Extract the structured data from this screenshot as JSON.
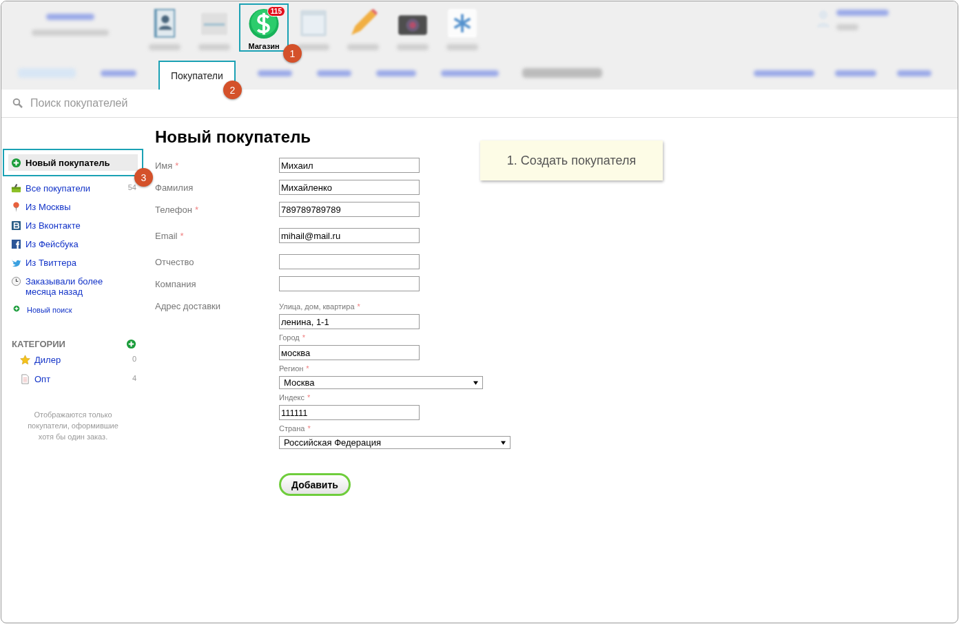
{
  "apps": [
    {
      "kind": "blurred",
      "selected": false
    },
    {
      "kind": "blurred",
      "selected": false
    },
    {
      "kind": "app",
      "label": "Магазин",
      "badge": "115",
      "selected": true
    },
    {
      "kind": "blurred",
      "selected": false
    },
    {
      "kind": "blurred",
      "selected": false
    },
    {
      "kind": "blurred",
      "selected": false
    },
    {
      "kind": "blurred",
      "selected": false
    }
  ],
  "tabs": [
    {
      "kind": "blurred",
      "selected": false
    },
    {
      "kind": "blurred",
      "selected": false
    },
    {
      "kind": "tab",
      "label": "Покупатели",
      "selected": true
    },
    {
      "kind": "blurred",
      "selected": false
    },
    {
      "kind": "blurred",
      "selected": false
    },
    {
      "kind": "blurred",
      "selected": false
    },
    {
      "kind": "blurred",
      "selected": false
    }
  ],
  "search": {
    "placeholder": "Поиск покупателей"
  },
  "sidebar": {
    "new_customer": {
      "label": "Новый покупатель",
      "selected": true
    },
    "filters": [
      {
        "label": "Все покупатели",
        "count": "54"
      },
      {
        "label": "Из Москвы"
      },
      {
        "label": "Из Вконтакте"
      },
      {
        "label": "Из Фейсбука"
      },
      {
        "label": "Из Твиттера"
      },
      {
        "label": "Заказывали более месяца назад"
      }
    ],
    "new_search": "Новый поиск",
    "categories": {
      "title": "КАТЕГОРИИ",
      "items": [
        {
          "label": "Дилер",
          "count": "0"
        },
        {
          "label": "Опт",
          "count": "4"
        }
      ]
    },
    "note": "Отображаются только покупатели, оформившие хотя бы один заказ."
  },
  "form": {
    "title": "Новый покупатель",
    "fields": [
      {
        "label": "Имя",
        "mark": "*",
        "value": "Михаил"
      },
      {
        "label": "Фамилия",
        "value": "Михайленко"
      },
      {
        "label": "Телефон",
        "mark": "*",
        "value": "789789789789"
      },
      {
        "label": "Email",
        "mark": "*",
        "value": "mihail@mail.ru"
      },
      {
        "label": "Отчество"
      },
      {
        "label": "Компания"
      }
    ],
    "address": {
      "label": "Адрес доставки",
      "fields": [
        {
          "kind": "text",
          "label": "Улица, дом, квартира",
          "mark": "*",
          "value": "ленина, 1-1"
        },
        {
          "kind": "text",
          "label": "Город",
          "mark": "*",
          "value": "москва"
        },
        {
          "kind": "select",
          "label": "Регион",
          "mark": "*",
          "value": "Москва"
        },
        {
          "kind": "text",
          "label": "Индекс",
          "mark": "*",
          "value": "111111"
        },
        {
          "kind": "select",
          "label": "Страна",
          "mark": "*",
          "value": "Российская Федерация"
        }
      ]
    },
    "submit": "Добавить"
  },
  "hint": "1. Создать покупателя",
  "annotations": [
    {
      "number": "1"
    },
    {
      "number": "2"
    },
    {
      "number": "3"
    }
  ]
}
